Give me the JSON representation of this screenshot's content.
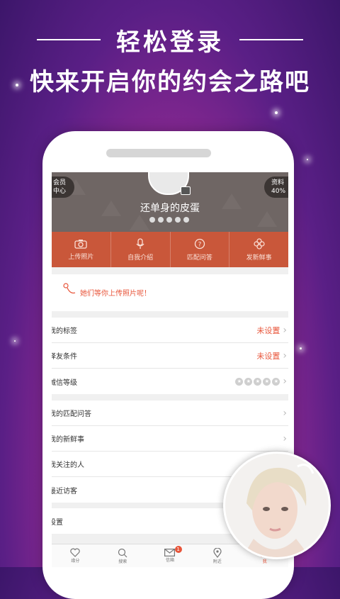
{
  "promo": {
    "title": "轻松登录",
    "subtitle": "快来开启你的约会之路吧"
  },
  "profile": {
    "nickname": "还单身的皮蛋",
    "member_badge_line1": "会员",
    "member_badge_line2": "中心",
    "profile_badge_line1": "资料",
    "profile_badge_line2": "40%"
  },
  "actions": [
    {
      "label": "上传照片",
      "icon": "camera-icon"
    },
    {
      "label": "自我介绍",
      "icon": "microphone-icon"
    },
    {
      "label": "匹配问答",
      "icon": "question-icon"
    },
    {
      "label": "发新鲜事",
      "icon": "flower-icon"
    }
  ],
  "hint": {
    "text": "她们等你上传照片呢！"
  },
  "list_group1": [
    {
      "label": "我的标签",
      "value": "未设置"
    },
    {
      "label": "择友条件",
      "value": "未设置"
    },
    {
      "label": "诚信等级",
      "value": ""
    }
  ],
  "list_group2": [
    {
      "label": "我的匹配问答"
    },
    {
      "label": "我的新鲜事"
    },
    {
      "label": "我关注的人"
    },
    {
      "label": "最近访客"
    }
  ],
  "settings": {
    "label": "设置"
  },
  "bottom_nav": [
    {
      "label": "缘分",
      "icon": "heart-icon"
    },
    {
      "label": "搜索",
      "icon": "search-icon"
    },
    {
      "label": "信箱",
      "icon": "mail-icon",
      "badge": "1"
    },
    {
      "label": "附近",
      "icon": "location-icon"
    },
    {
      "label": "我",
      "icon": "person-icon"
    }
  ],
  "colors": {
    "accent": "#e8553a",
    "action_bar": "#c9573a",
    "header": "#6f6664"
  }
}
